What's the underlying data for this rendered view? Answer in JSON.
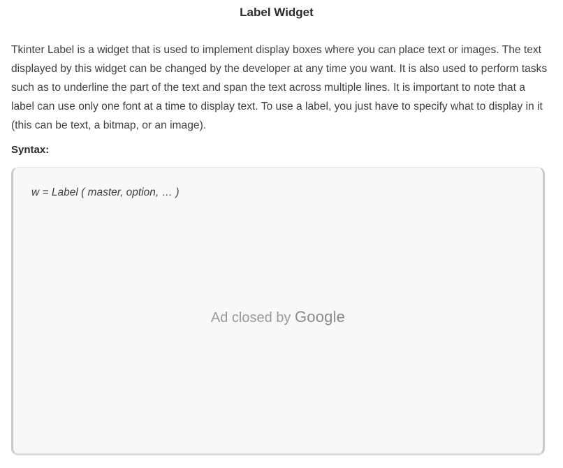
{
  "article": {
    "heading": "Label Widget",
    "paragraph": "Tkinter Label is a widget that is used to implement display boxes where you can place text or images. The text displayed by this widget can be changed by the developer at any time you want. It is also used to perform tasks such as to underline the part of the text and span the text across multiple lines. It is important to note that a label can use only one font at a time to display text. To use a label, you just have to specify what to display in it (this can be text, a bitmap, or an image).",
    "syntax_label": "Syntax:",
    "code": "w = Label ( master, option, … )"
  },
  "ad": {
    "closed_text": "Ad closed by",
    "brand": "Google"
  }
}
